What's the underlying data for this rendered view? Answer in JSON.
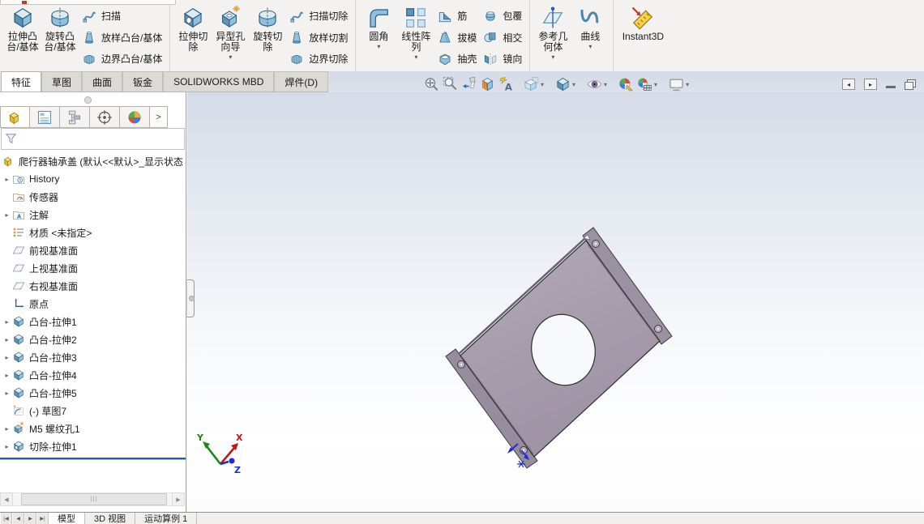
{
  "icons": {
    "dropdown": "▾",
    "expand": "▸",
    "chevron_right": ">",
    "scroll_left": "◀",
    "scroll_right": "▶",
    "nav_first": "|◀",
    "nav_prev": "◀",
    "nav_next": "▶",
    "nav_last": "▶|",
    "grip": "|||"
  },
  "ribbon": {
    "tabs": [
      {
        "label": "特征",
        "active": true
      },
      {
        "label": "草图",
        "active": false
      },
      {
        "label": "曲面",
        "active": false
      },
      {
        "label": "钣金",
        "active": false
      },
      {
        "label": "SOLIDWORKS MBD",
        "active": false
      },
      {
        "label": "焊件(D)",
        "active": false
      }
    ],
    "groups": {
      "features": {
        "extrude_boss": "拉伸凸台/基体",
        "revolve_boss": "旋转凸台/基体",
        "sweep": "扫描",
        "loft": "放样凸台/基体",
        "boundary": "边界凸台/基体"
      },
      "cuts": {
        "extrude_cut": "拉伸切除",
        "hole_wizard": "异型孔向导",
        "revolve_cut": "旋转切除",
        "sweep_cut": "扫描切除",
        "loft_cut": "放样切割",
        "boundary_cut": "边界切除"
      },
      "modify": {
        "fillet": "圆角",
        "linear_pattern": "线性阵列",
        "rib": "筋",
        "draft": "拔模",
        "shell": "抽壳",
        "wrap": "包覆",
        "intersect": "相交",
        "mirror": "镜向"
      },
      "reference": {
        "ref_geometry": "参考几何体",
        "curves": "曲线"
      },
      "instant3d": "Instant3D"
    }
  },
  "heads_up_toolbar": {
    "icons": [
      "zoom-to-fit",
      "zoom-to-area",
      "previous-view",
      "section-view",
      "hide-show-annotations",
      "view-orientation",
      "display-style",
      "hide-show-items",
      "edit-appearance",
      "apply-scene",
      "view-settings"
    ]
  },
  "window_controls": [
    "collapse-pane-left",
    "collapse-pane-right",
    "minimize",
    "restore"
  ],
  "feature_manager": {
    "panel_tabs": [
      "featuremanager-design-tree",
      "propertymanager",
      "configurationmanager",
      "dimxpertmanager",
      "displaymanager"
    ],
    "root_label": "爬行器轴承盖 (默认<<默认>_显示状态",
    "items": [
      {
        "label": "History",
        "icon": "history-folder",
        "expandable": true
      },
      {
        "label": "传感器",
        "icon": "sensors-folder",
        "expandable": false
      },
      {
        "label": "注解",
        "icon": "annotations-folder",
        "expandable": true
      },
      {
        "label": "材质 <未指定>",
        "icon": "material",
        "expandable": false
      },
      {
        "label": "前视基准面",
        "icon": "plane",
        "expandable": false
      },
      {
        "label": "上视基准面",
        "icon": "plane",
        "expandable": false
      },
      {
        "label": "右视基准面",
        "icon": "plane",
        "expandable": false
      },
      {
        "label": "原点",
        "icon": "origin",
        "expandable": false
      },
      {
        "label": "凸台-拉伸1",
        "icon": "boss-extrude",
        "expandable": true
      },
      {
        "label": "凸台-拉伸2",
        "icon": "boss-extrude",
        "expandable": true
      },
      {
        "label": "凸台-拉伸3",
        "icon": "boss-extrude",
        "expandable": true
      },
      {
        "label": "凸台-拉伸4",
        "icon": "boss-extrude",
        "expandable": true
      },
      {
        "label": "凸台-拉伸5",
        "icon": "boss-extrude",
        "expandable": true
      },
      {
        "label": "(-) 草图7",
        "icon": "sketch",
        "expandable": false
      },
      {
        "label": "M5 螺纹孔1",
        "icon": "hole-wizard",
        "expandable": true
      },
      {
        "label": "切除-拉伸1",
        "icon": "cut-extrude",
        "expandable": true
      }
    ]
  },
  "status_bar": {
    "tabs": [
      {
        "label": "模型",
        "active": true
      },
      {
        "label": "3D 视图",
        "active": false
      },
      {
        "label": "运动算例 1",
        "active": false
      }
    ]
  },
  "triad": {
    "x_label": "X",
    "y_label": "Y",
    "z_label": "Z"
  },
  "colors": {
    "model_plate": "#a89cac",
    "model_flange": "#9a8fa1",
    "rollback_bar": "#2456c9",
    "triad_x": "#c21717",
    "triad_y": "#168a16",
    "triad_z": "#1b2fd4",
    "viewport_gradient_top": "#d5dbe7",
    "viewport_gradient_bottom": "#ffffff"
  }
}
